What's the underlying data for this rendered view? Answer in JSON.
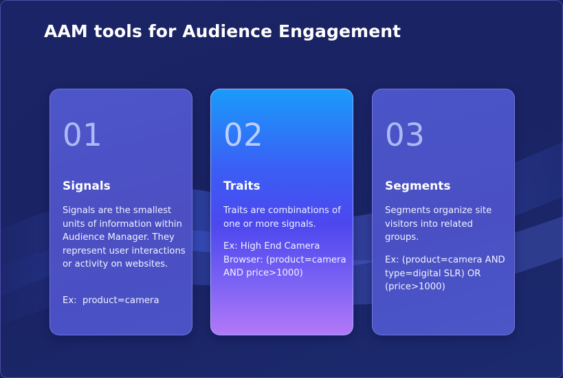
{
  "slide": {
    "title": "AAM tools for Audience Engagement"
  },
  "cards": [
    {
      "number": "01",
      "title": "Signals",
      "description": "Signals are the smallest units of information within Audience Manager. They represent user interactions or activity on websites.",
      "example": "Ex:  product=camera"
    },
    {
      "number": "02",
      "title": "Traits",
      "description": "Traits are combinations of one or more signals.",
      "example": "Ex: High End Camera Browser: (product=camera AND price>1000)"
    },
    {
      "number": "03",
      "title": "Segments",
      "description": "Segments organize site visitors into related groups.",
      "example": "Ex: (product=camera AND type=digital SLR) OR (price>1000)"
    }
  ],
  "colors": {
    "background": "#1b2466",
    "card": "#4b50c3",
    "highlight_top": "#1a9bfa",
    "highlight_bottom": "#b378f7"
  }
}
